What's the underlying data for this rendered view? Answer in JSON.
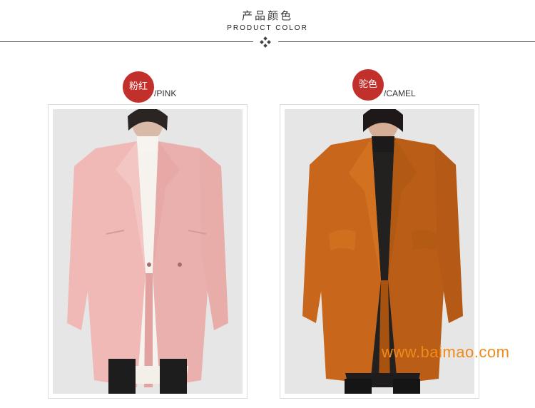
{
  "header": {
    "title_cn": "产品颜色",
    "title_en": "PRODUCT COLOR"
  },
  "variants": [
    {
      "name_cn": "粉红",
      "name_en": "/PINK",
      "coat_color": "#f0b9b6"
    },
    {
      "name_cn": "驼色",
      "name_en": "/CAMEL",
      "coat_color": "#c8671c"
    }
  ],
  "colors": {
    "badge": "#c2302c",
    "photo_bg": "#e6e6e6"
  },
  "watermark": "www.baimao.com"
}
